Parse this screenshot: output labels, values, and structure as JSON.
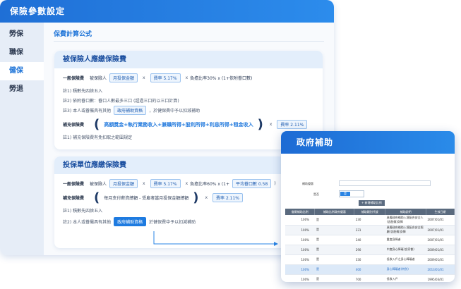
{
  "window": {
    "title": "保險參數設定"
  },
  "sidebar": {
    "items": [
      {
        "label": "勞保",
        "active": false
      },
      {
        "label": "職保",
        "active": false
      },
      {
        "label": "健保",
        "active": true
      },
      {
        "label": "勞退",
        "active": false
      }
    ]
  },
  "main": {
    "section_title": "保費計算公式",
    "insured": {
      "title": "被保險人應繳保險費",
      "general": {
        "label": "一般保險費",
        "who": "被保險人",
        "salary": "月投保金額",
        "x1": "x",
        "rate": "費率 5.17%",
        "x2": "x",
        "ratio": "負擔比率30% x (1+依附眷口數)"
      },
      "notes": [
        "註1) 積數先四捨五入",
        "註2) 依附眷口數：眷口人數最多三口 (超過三口的以三口計算)"
      ],
      "note3_prefix": "註3) 本人或眷屬具有其他",
      "note3_tag": "政府補助資格",
      "note3_suffix": "，於健保費中予以扣減補助",
      "supplementary": {
        "label": "補充保險費",
        "formula": "高額獎金+執行業務收入+兼職所得+股利所得+利息所得+租金收入",
        "x": "x",
        "rate": "費率 2.11%"
      },
      "supp_note": "註1) 補充保險費有免扣取之範圍規定"
    },
    "employer": {
      "title": "投保單位應繳保險費",
      "general": {
        "label": "一般保險費",
        "who": "被保險人",
        "salary": "月投保金額",
        "x1": "x",
        "rate": "費率 5.17%",
        "x2": "x",
        "ratio": "負擔比率60% x (1+",
        "dependents": "平均眷口數 0.58",
        "close": ")"
      },
      "supplementary": {
        "label": "補充保險費",
        "formula": "每月支付薪資總額 - 受雇者當月投保金額總額",
        "x": "x",
        "rate": "費率 2.11%"
      },
      "notes": [
        "註1) 積數先四捨五入"
      ],
      "note2_prefix": "註2) 本人或眷屬具有其他",
      "note2_tag": "政府補助資格",
      "note2_suffix": "於健保費中予以扣減補助"
    }
  },
  "gov": {
    "title": "政府補助",
    "fields": {
      "code_label": "補助優惠",
      "enable_label": "是否",
      "toggle_on": "是",
      "add_button": "+ 新增補助比例"
    },
    "columns": [
      "眷屬補助比例",
      "補助比例政府優惠",
      "補助類別代號",
      "補助說明",
      "生效日期"
    ],
    "rows": [
      {
        "pct": "100%",
        "gov": "是",
        "code": "230",
        "desc": "具備政府補助入境配合安全人(含配偶)身障",
        "date": "2007/01/01"
      },
      {
        "pct": "100%",
        "gov": "是",
        "code": "231",
        "desc": "具備政府補助入境配合安全照顧(含配偶)身障",
        "date": "2007/01/01"
      },
      {
        "pct": "100%",
        "gov": "是",
        "code": "240",
        "desc": "重度身障者",
        "date": "2007/01/01"
      },
      {
        "pct": "100%",
        "gov": "是",
        "code": "290",
        "desc": "中度身心障礙(含家眷)",
        "date": "2009/01/01"
      },
      {
        "pct": "100%",
        "gov": "是",
        "code": "330",
        "desc": "低收入戶之身心障礙者",
        "date": "2009/01/01"
      },
      {
        "pct": "100%",
        "gov": "是",
        "code": "400",
        "desc": "身心障礙者(特別)",
        "date": "2013/01/01"
      },
      {
        "pct": "100%",
        "gov": "是",
        "code": "700",
        "desc": "低收入戶",
        "date": "1995/03/01"
      }
    ]
  },
  "colors": {
    "primary": "#1e74d8",
    "header": "#2c8cec",
    "accent": "#2179dd"
  }
}
